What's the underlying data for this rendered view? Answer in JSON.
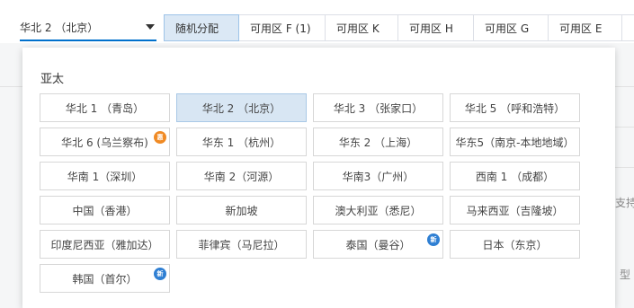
{
  "region_select": {
    "value": "华北 2 （北京）"
  },
  "zone_tabs": [
    {
      "label": "随机分配",
      "active": true
    },
    {
      "label": "可用区 F (1)",
      "active": false
    },
    {
      "label": "可用区 K",
      "active": false
    },
    {
      "label": "可用区 H",
      "active": false
    },
    {
      "label": "可用区 G",
      "active": false
    },
    {
      "label": "可用区 E",
      "active": false
    },
    {
      "label": "",
      "active": false
    }
  ],
  "background": {
    "side_text_1": "支持",
    "side_text_2": "型"
  },
  "dropdown": {
    "group_title": "亚太",
    "regions": [
      {
        "label": "华北 1 （青岛）"
      },
      {
        "label": "华北 2 （北京）",
        "selected": true
      },
      {
        "label": "华北 3 （张家口）"
      },
      {
        "label": "华北 5 （呼和浩特）"
      },
      {
        "label": "华北 6 (乌兰察布)",
        "badge": "hot",
        "badge_text": "惠"
      },
      {
        "label": "华东 1 （杭州）"
      },
      {
        "label": "华东 2 （上海）"
      },
      {
        "label": "华东5（南京-本地地域）"
      },
      {
        "label": "华南 1（深圳）"
      },
      {
        "label": "华南 2（河源）"
      },
      {
        "label": "华南3（广州）"
      },
      {
        "label": "西南 1 （成都）"
      },
      {
        "label": "中国（香港）"
      },
      {
        "label": "新加坡"
      },
      {
        "label": "澳大利亚（悉尼）"
      },
      {
        "label": "马来西亚（吉隆坡）"
      },
      {
        "label": "印度尼西亚（雅加达）"
      },
      {
        "label": "菲律宾（马尼拉）"
      },
      {
        "label": "泰国（曼谷）",
        "badge": "new",
        "badge_text": "新"
      },
      {
        "label": "日本（东京）"
      },
      {
        "label": "韩国（首尔）",
        "badge": "new",
        "badge_text": "新"
      }
    ]
  }
}
